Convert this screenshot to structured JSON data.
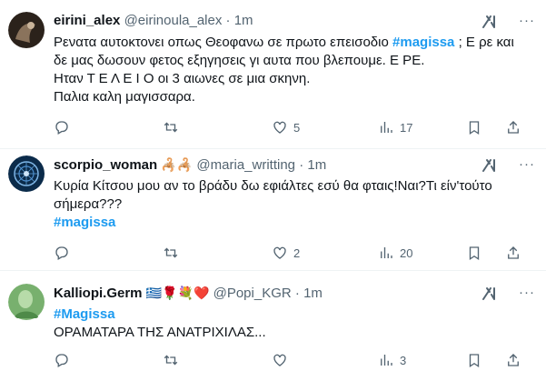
{
  "tweets": [
    {
      "name": "eirini_alex",
      "handle": "@eirinoula_alex",
      "dot": "·",
      "time": "1m",
      "lines": [
        [
          "Ρενατα αυτοκτονει οπως Θεοφανω σε πρωτο επεισοδιο ",
          "#magissa",
          " ; Ε ρε και"
        ],
        [
          "δε μας δωσουν φετος εξηγησεις γι αυτα που βλεπουμε. Ε ΡΕ."
        ],
        [
          "Ηταν Τ Ε Λ Ε Ι Ο οι 3 αιωνες σε μια σκηνη."
        ],
        [
          "Παλια καλη μαγισσαρα."
        ]
      ],
      "likes": "5",
      "views": "17"
    },
    {
      "name": "scorpio_woman",
      "name_emoji": "🦂🦂",
      "handle": "@maria_writting",
      "dot": "·",
      "time": "1m",
      "line1": "Κυρία Κίτσου μου αν το βράδυ δω εφιάλτες εσύ θα φταις!Ναι?Τι είν'τούτο",
      "line2": "σήμερα???",
      "hashtag": "#magissa",
      "likes": "2",
      "views": "20"
    },
    {
      "name": "Kalliopi.Germ",
      "name_emoji": "🇬🇷🌹💐❤️",
      "handle": "@Popi_KGR",
      "dot": "·",
      "time": "1m",
      "hashtag": "#Magissa",
      "line2": "ΟΡΑΜΑΤΑΡΑ ΤΗΣ ΑΝΑΤΡΙΧΙΛΑΣ...",
      "views": "3"
    }
  ],
  "icons": {
    "grok": "grok-icon",
    "more": "more-icon",
    "reply": "reply-icon",
    "retweet": "retweet-icon",
    "like": "like-icon",
    "views": "views-icon",
    "bookmark": "bookmark-icon",
    "share": "share-icon"
  },
  "colors": {
    "hashtag": "#1d9bf0",
    "muted": "#536471",
    "text": "#0f1419"
  }
}
